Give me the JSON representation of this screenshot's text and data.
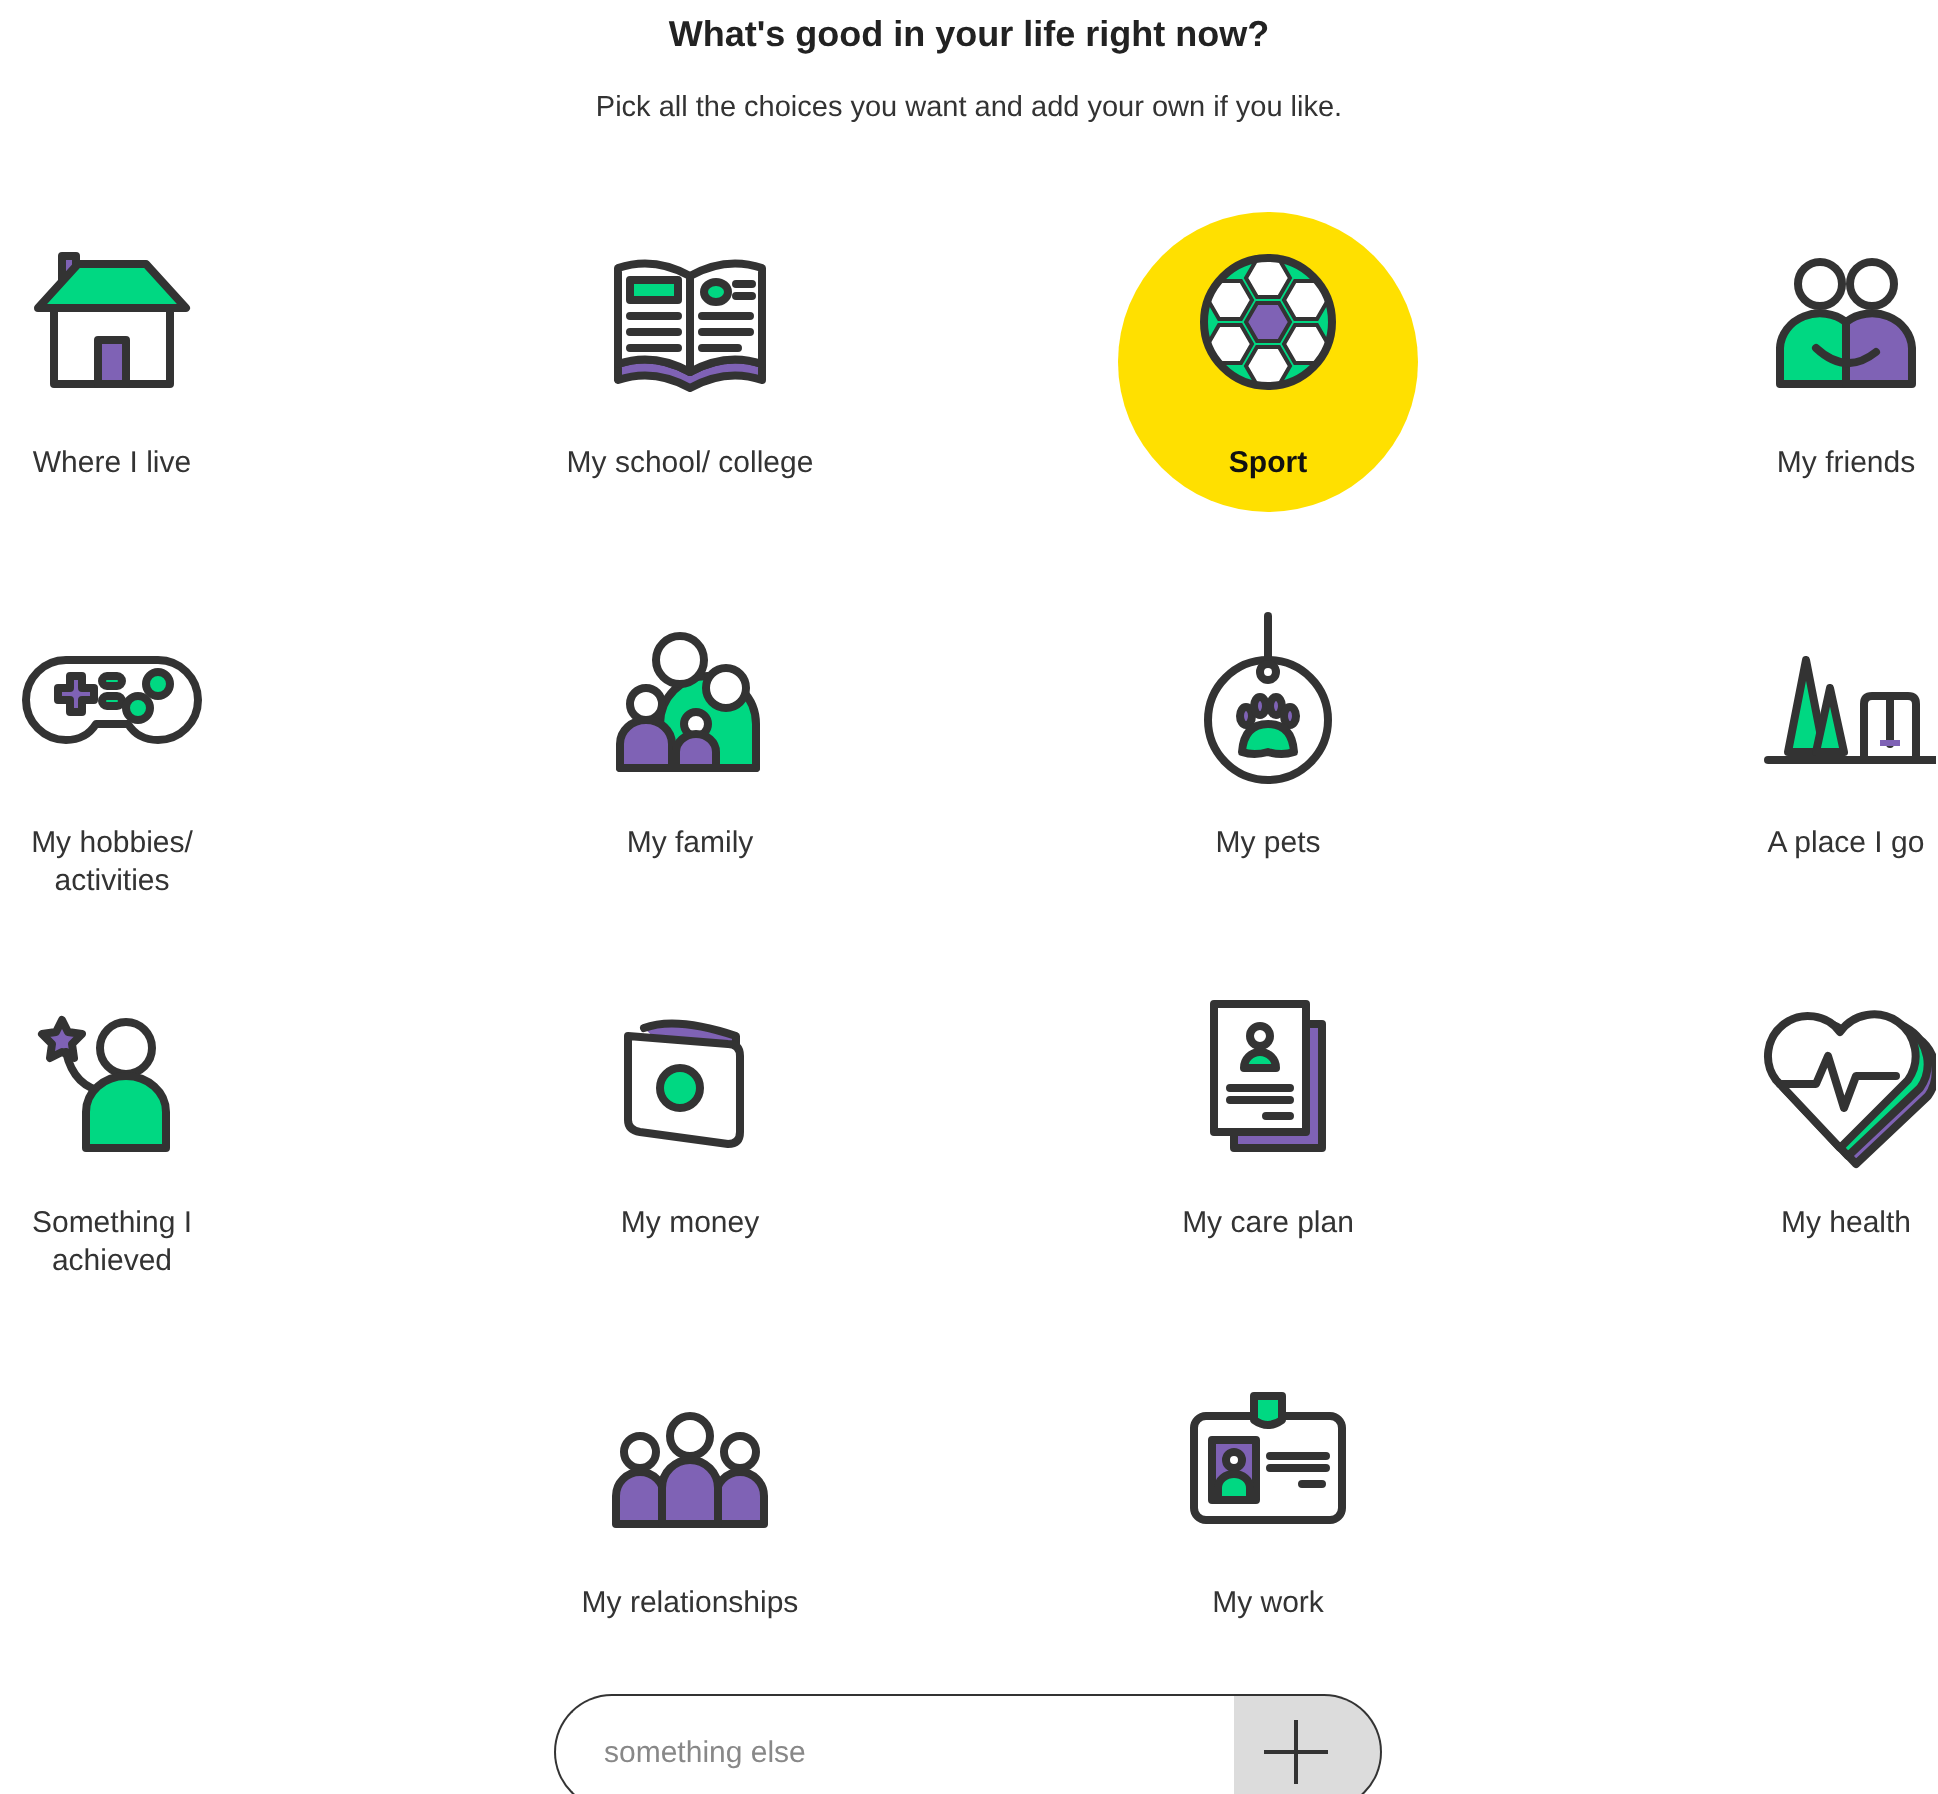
{
  "heading": {
    "title": "What's good in your life right now?",
    "subtitle": "Pick all the choices you want and add your own if you like."
  },
  "choices": [
    {
      "label": "Where I live",
      "selected": false
    },
    {
      "label": "My school/ college",
      "selected": false
    },
    {
      "label": "Sport",
      "selected": true
    },
    {
      "label": "My friends",
      "selected": false
    },
    {
      "label": "My hobbies/\nactivities",
      "selected": false
    },
    {
      "label": "My family",
      "selected": false
    },
    {
      "label": "My pets",
      "selected": false
    },
    {
      "label": "A place I go",
      "selected": false
    },
    {
      "label": "Something I\nachieved",
      "selected": false
    },
    {
      "label": "My money",
      "selected": false
    },
    {
      "label": "My care plan",
      "selected": false
    },
    {
      "label": "My health",
      "selected": false
    },
    {
      "label": "My relationships",
      "selected": false
    },
    {
      "label": "My work",
      "selected": false
    }
  ],
  "custom_entry": {
    "placeholder": "something else"
  }
}
